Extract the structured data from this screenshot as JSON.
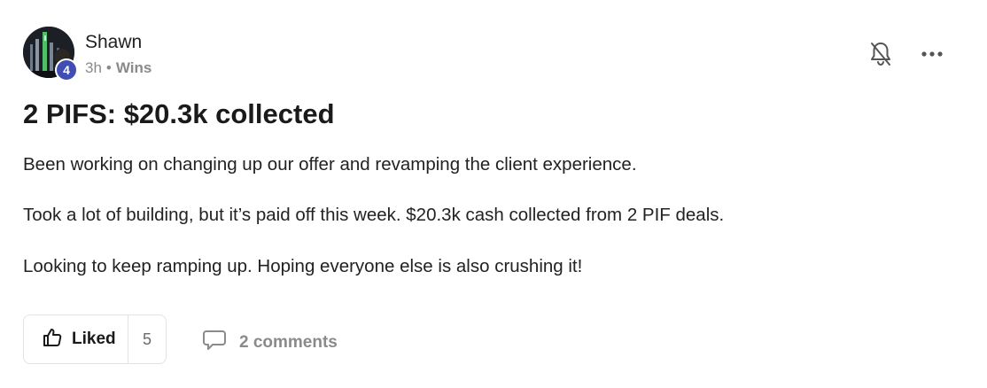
{
  "post": {
    "author": {
      "name": "Shawn",
      "level": "4"
    },
    "meta": {
      "time": "3h",
      "separator": "•",
      "category": "Wins"
    },
    "title": "2 PIFS: $20.3k collected",
    "paragraphs": [
      "Been working on changing up our offer and revamping the client experience.",
      "Took a lot of building, but it’s paid off this week. $20.3k cash collected from 2 PIF deals.",
      "Looking to keep ramping up. Hoping everyone else is also crushing it!"
    ],
    "actions": {
      "like_label": "Liked",
      "like_count": "5",
      "comments_label": "2 comments"
    },
    "icons": {
      "bell": "bell-off-icon",
      "more": "more-horizontal-icon",
      "like": "thumbs-up-icon",
      "comment": "comment-bubble-icon"
    },
    "colors": {
      "level_badge": "#3f4db5",
      "muted_text": "#8a8a8a"
    }
  }
}
